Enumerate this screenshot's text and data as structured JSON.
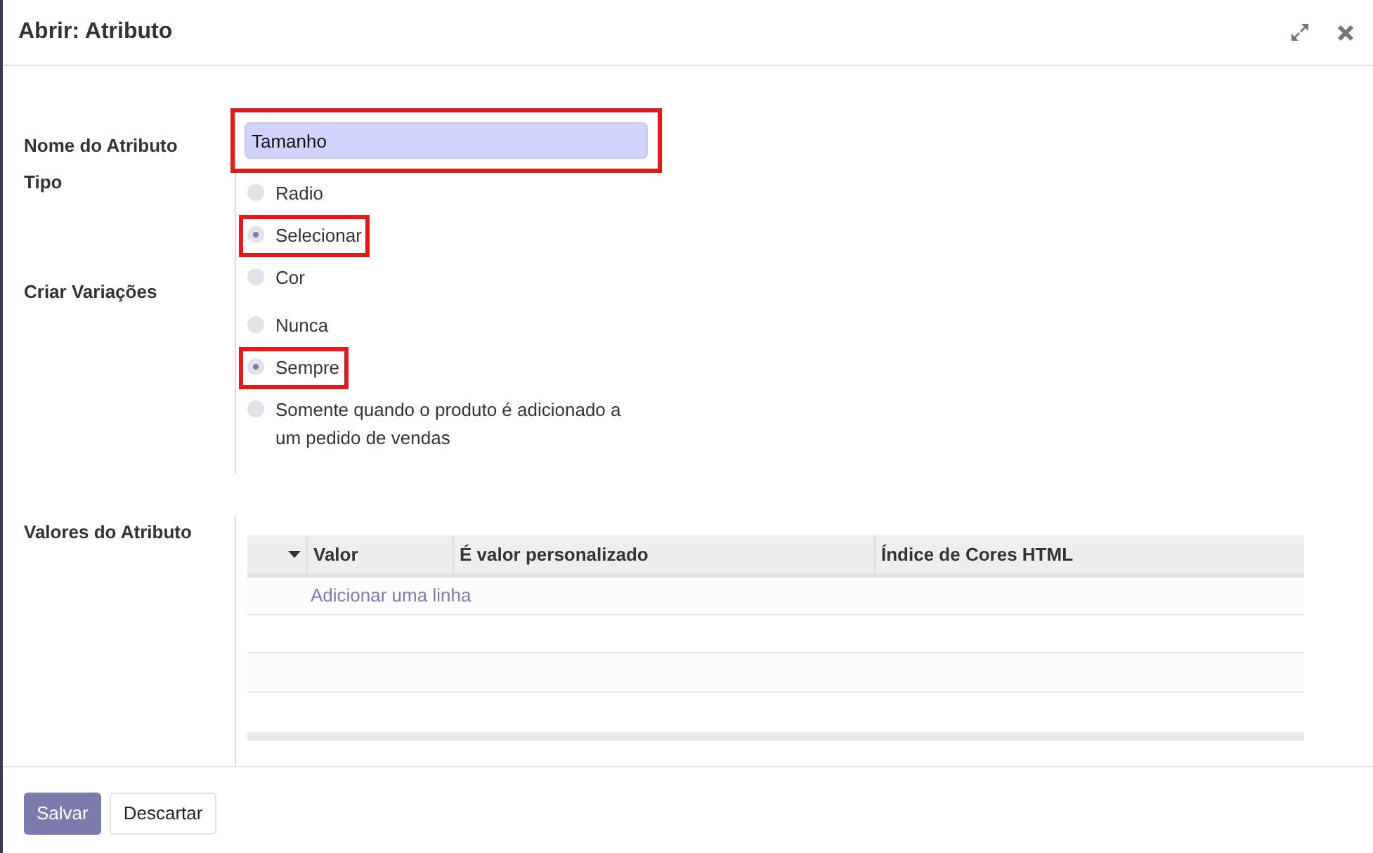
{
  "dialog": {
    "title": "Abrir: Atributo"
  },
  "name_field": {
    "label": "Nome do Atributo",
    "value": "Tamanho",
    "highlighted": true
  },
  "type_field": {
    "label": "Tipo",
    "options": [
      {
        "label": "Radio",
        "selected": false,
        "highlighted": false
      },
      {
        "label": "Selecionar",
        "selected": true,
        "highlighted": true
      },
      {
        "label": "Cor",
        "selected": false,
        "highlighted": false
      }
    ]
  },
  "variants_field": {
    "label": "Criar Variações",
    "options": [
      {
        "label": "Nunca",
        "selected": false,
        "highlighted": false
      },
      {
        "label": "Sempre",
        "selected": true,
        "highlighted": true
      },
      {
        "label": "Somente quando o produto é adicionado a um pedido de vendas",
        "selected": false,
        "highlighted": false
      }
    ]
  },
  "values_table": {
    "label": "Valores do Atributo",
    "columns": [
      "Valor",
      "É valor personalizado",
      "Índice de Cores HTML"
    ],
    "add_line": "Adicionar uma linha"
  },
  "buttons": [
    {
      "label": "Salvar",
      "kind": "primary"
    },
    {
      "label": "Descartar",
      "kind": "secondary"
    }
  ]
}
